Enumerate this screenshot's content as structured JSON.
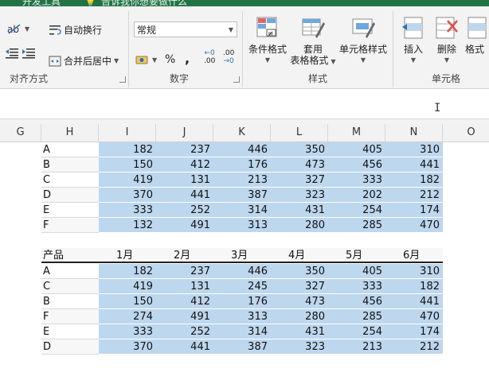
{
  "topbar": {
    "tab1": "开发工具",
    "tab2": "告诉我你想要做什么"
  },
  "ribbon": {
    "wrap_text": "自动换行",
    "merge_center": "合并后居中",
    "align_group": "对齐方式",
    "number_format": "常规",
    "percent": "%",
    "comma": ",",
    "dec_inc": ".00",
    "dec_dec": ".00",
    "number_group": "数字",
    "cond_format": "条件格式",
    "table_format_1": "套用",
    "table_format_2": "表格格式",
    "cell_style": "单元格样式",
    "style_group": "样式",
    "insert": "插入",
    "delete": "删除",
    "format": "格式",
    "cells_group": "单元格"
  },
  "columns": [
    "G",
    "H",
    "I",
    "J",
    "K",
    "L",
    "M",
    "N",
    "O"
  ],
  "table1": [
    {
      "label": "A",
      "values": [
        "182",
        "237",
        "446",
        "350",
        "405",
        "310"
      ]
    },
    {
      "label": "B",
      "values": [
        "150",
        "412",
        "176",
        "473",
        "456",
        "441"
      ]
    },
    {
      "label": "C",
      "values": [
        "419",
        "131",
        "213",
        "327",
        "333",
        "182"
      ]
    },
    {
      "label": "D",
      "values": [
        "370",
        "441",
        "387",
        "323",
        "202",
        "212"
      ]
    },
    {
      "label": "E",
      "values": [
        "333",
        "252",
        "314",
        "431",
        "254",
        "174"
      ]
    },
    {
      "label": "F",
      "values": [
        "132",
        "491",
        "313",
        "280",
        "285",
        "470"
      ]
    }
  ],
  "table2": {
    "header": {
      "label": "产品",
      "values": [
        "1月",
        "2月",
        "3月",
        "4月",
        "5月",
        "6月"
      ]
    },
    "rows": [
      {
        "label": "A",
        "values": [
          "182",
          "237",
          "446",
          "350",
          "405",
          "310"
        ]
      },
      {
        "label": "C",
        "values": [
          "419",
          "131",
          "245",
          "327",
          "333",
          "182"
        ]
      },
      {
        "label": "B",
        "values": [
          "150",
          "412",
          "176",
          "473",
          "456",
          "441"
        ]
      },
      {
        "label": "F",
        "values": [
          "274",
          "491",
          "313",
          "280",
          "285",
          "470"
        ]
      },
      {
        "label": "E",
        "values": [
          "333",
          "252",
          "314",
          "431",
          "254",
          "174"
        ]
      },
      {
        "label": "D",
        "values": [
          "370",
          "441",
          "387",
          "323",
          "213",
          "212"
        ]
      }
    ]
  },
  "colors": {
    "ribbon_green": "#217346",
    "cell_fill": "#bdd7ee"
  }
}
